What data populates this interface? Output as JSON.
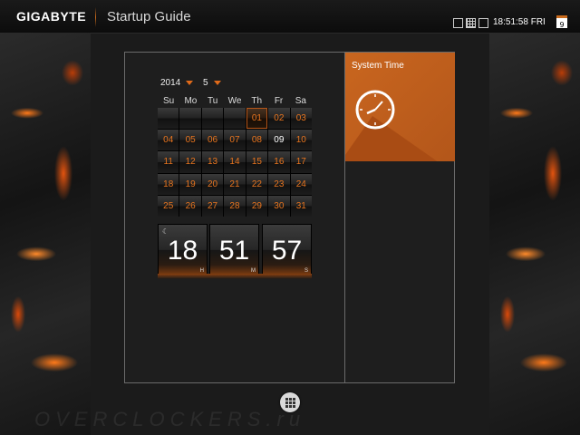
{
  "header": {
    "brand": "GIGABYTE",
    "title": "Startup Guide",
    "clock": "18:51:58 FRI",
    "calendar_day": "9"
  },
  "calendar": {
    "year": "2014",
    "month": "5",
    "weekdays": [
      "Su",
      "Mo",
      "Tu",
      "We",
      "Th",
      "Fr",
      "Sa"
    ],
    "days": [
      "",
      "",
      "",
      "",
      "01",
      "02",
      "03",
      "04",
      "05",
      "06",
      "07",
      "08",
      "09",
      "10",
      "11",
      "12",
      "13",
      "14",
      "15",
      "16",
      "17",
      "18",
      "19",
      "20",
      "21",
      "22",
      "23",
      "24",
      "25",
      "26",
      "27",
      "28",
      "29",
      "30",
      "31"
    ],
    "today_index": 12
  },
  "flip_clock": {
    "hours": "18",
    "minutes": "51",
    "seconds": "57",
    "hours_unit": "H",
    "minutes_unit": "M",
    "seconds_unit": "S"
  },
  "tile": {
    "label": "System Time",
    "icon": "clock-icon"
  },
  "watermark": "OVERCLOCKERS.ru",
  "colors": {
    "accent": "#c96a1c",
    "text_orange": "#e8751f"
  }
}
